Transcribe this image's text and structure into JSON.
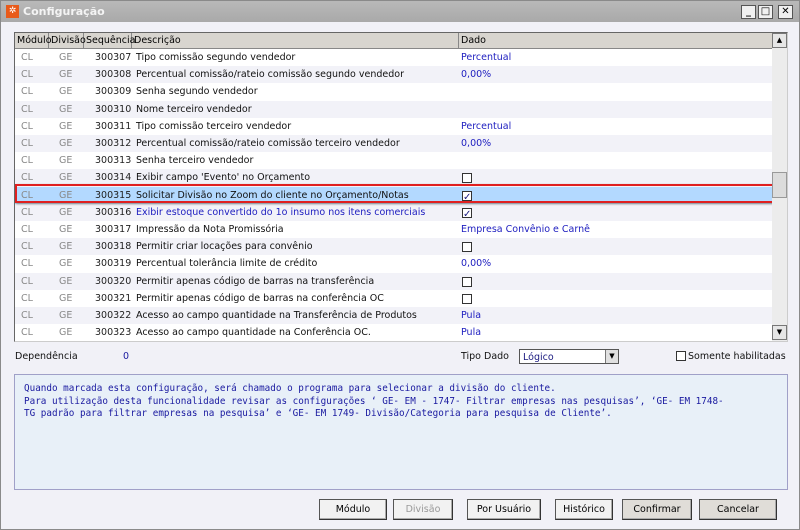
{
  "window": {
    "title": "Configuração",
    "minimize": "_",
    "maximize": "□",
    "close": "✕"
  },
  "grid": {
    "columns": [
      "Módulo",
      "Divisão",
      "Sequência",
      "Descrição",
      "Dado"
    ],
    "rows": [
      {
        "modulo": "CL",
        "divisao": "GE",
        "seq": "300307",
        "desc": "Tipo comissão segundo vendedor",
        "dado": "Percentual"
      },
      {
        "modulo": "CL",
        "divisao": "GE",
        "seq": "300308",
        "desc": "Percentual comissão/rateio comissão segundo vendedor",
        "dado": "0,00%"
      },
      {
        "modulo": "CL",
        "divisao": "GE",
        "seq": "300309",
        "desc": "Senha segundo vendedor",
        "dado": ""
      },
      {
        "modulo": "CL",
        "divisao": "GE",
        "seq": "300310",
        "desc": "Nome terceiro vendedor",
        "dado": ""
      },
      {
        "modulo": "CL",
        "divisao": "GE",
        "seq": "300311",
        "desc": "Tipo comissão terceiro vendedor",
        "dado": "Percentual"
      },
      {
        "modulo": "CL",
        "divisao": "GE",
        "seq": "300312",
        "desc": "Percentual comissão/rateio comissão terceiro vendedor",
        "dado": "0,00%"
      },
      {
        "modulo": "CL",
        "divisao": "GE",
        "seq": "300313",
        "desc": "Senha terceiro vendedor",
        "dado": ""
      },
      {
        "modulo": "CL",
        "divisao": "GE",
        "seq": "300314",
        "desc": "Exibir campo 'Evento' no Orçamento",
        "checkbox": false
      },
      {
        "modulo": "CL",
        "divisao": "GE",
        "seq": "300315",
        "desc": "Solicitar Divisão no Zoom do cliente no Orçamento/Notas",
        "checkbox": true,
        "selected": true
      },
      {
        "modulo": "CL",
        "divisao": "GE",
        "seq": "300316",
        "desc": "Exibir estoque convertido do 1o insumo nos itens comerciais",
        "checkbox": true,
        "highlight": true
      },
      {
        "modulo": "CL",
        "divisao": "GE",
        "seq": "300317",
        "desc": "Impressão da Nota Promissória",
        "dado": "Empresa Convênio e Carnê"
      },
      {
        "modulo": "CL",
        "divisao": "GE",
        "seq": "300318",
        "desc": "Permitir criar locações para convênio",
        "checkbox": false
      },
      {
        "modulo": "CL",
        "divisao": "GE",
        "seq": "300319",
        "desc": "Percentual tolerância limite de crédito",
        "dado": "0,00%"
      },
      {
        "modulo": "CL",
        "divisao": "GE",
        "seq": "300320",
        "desc": "Permitir apenas código de barras na transferência",
        "checkbox": false
      },
      {
        "modulo": "CL",
        "divisao": "GE",
        "seq": "300321",
        "desc": "Permitir apenas código de barras na conferência OC",
        "checkbox": false
      },
      {
        "modulo": "CL",
        "divisao": "GE",
        "seq": "300322",
        "desc": "Acesso ao campo quantidade na Transferência de Produtos",
        "dado": "Pula"
      },
      {
        "modulo": "CL",
        "divisao": "GE",
        "seq": "300323",
        "desc": "Acesso ao campo quantidade na Conferência OC.",
        "dado": "Pula"
      }
    ]
  },
  "footer": {
    "dependencia_label": "Dependência",
    "dependencia_value": "0",
    "tipo_dado_label": "Tipo Dado",
    "tipo_dado_value": "Lógico",
    "somente_label": "Somente habilitadas",
    "somente_checked": false
  },
  "memo": [
    "Quando marcada esta configuração, será chamado o programa para selecionar a divisão do cliente.",
    "Para utilização desta funcionalidade revisar as configurações ‘ GE- EM - 1747- Filtrar empresas nas pesquisas’, ‘GE- EM 1748-",
    "TG padrão para filtrar empresas na pesquisa’ e ‘GE- EM 1749- Divisão/Categoria para pesquisa de Cliente’."
  ],
  "buttons": {
    "modulo": "Módulo",
    "divisao": "Divisão",
    "por_usuario": "Por Usuário",
    "historico": "Histórico",
    "confirmar": "Confirmar",
    "cancelar": "Cancelar"
  },
  "colors": {
    "accent": "#2020c0",
    "selected_row": "#b3d9ff",
    "highlight_border": "#e02020"
  }
}
